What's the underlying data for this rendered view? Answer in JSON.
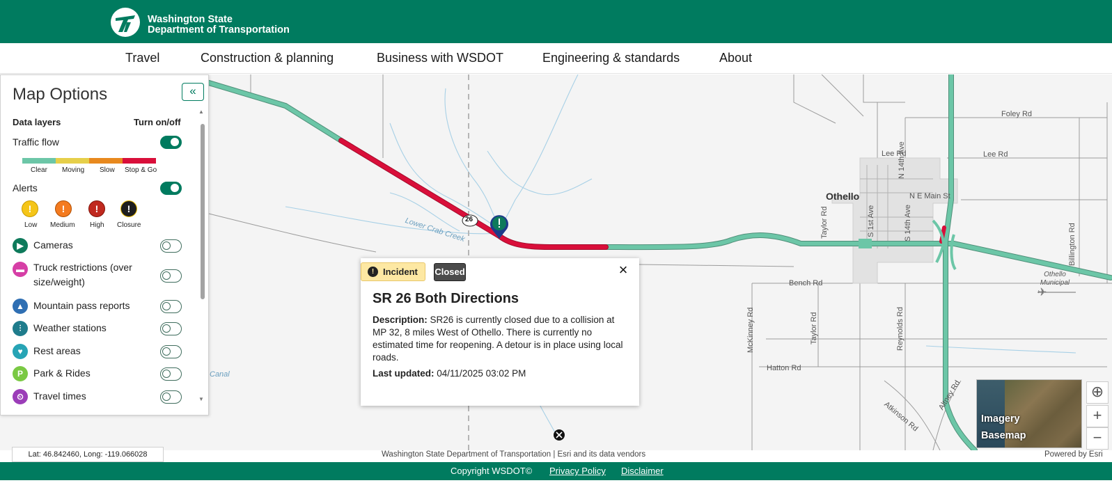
{
  "header": {
    "brand_line1": "Washington State",
    "brand_line2": "Department of Transportation",
    "logo_icon": "wsdot-logo-icon",
    "color": "#007b5f"
  },
  "nav": {
    "items": [
      {
        "label": "Travel"
      },
      {
        "label": "Construction & planning"
      },
      {
        "label": "Business with WSDOT"
      },
      {
        "label": "Engineering & standards"
      },
      {
        "label": "About"
      }
    ]
  },
  "panel": {
    "title": "Map Options",
    "collapse_icon": "double-chevron-left-icon",
    "col_layers": "Data layers",
    "col_toggle": "Turn on/off",
    "traffic_flow": {
      "label": "Traffic flow",
      "on": true,
      "legend": [
        {
          "label": "Clear",
          "color": "#6cc6a7"
        },
        {
          "label": "Moving",
          "color": "#e6cf4a"
        },
        {
          "label": "Slow",
          "color": "#e8891e"
        },
        {
          "label": "Stop & Go",
          "color": "#d90f3a"
        }
      ]
    },
    "alerts": {
      "label": "Alerts",
      "on": true,
      "levels": [
        {
          "label": "Low",
          "color": "#f5c518"
        },
        {
          "label": "Medium",
          "color": "#f47b20"
        },
        {
          "label": "High",
          "color": "#c0291f"
        },
        {
          "label": "Closure",
          "color": "#1e1e1e"
        }
      ]
    },
    "layers": [
      {
        "label": "Cameras",
        "icon": "camera-icon",
        "color": "#0e7a5b",
        "on": false
      },
      {
        "label": "Truck restrictions (over size/weight)",
        "icon": "truck-icon",
        "color": "#d63fa6",
        "on": false
      },
      {
        "label": "Mountain pass reports",
        "icon": "mountain-icon",
        "color": "#2f6fb3",
        "on": false
      },
      {
        "label": "Weather stations",
        "icon": "weather-station-icon",
        "color": "#1f7c8c",
        "on": false
      },
      {
        "label": "Rest areas",
        "icon": "rest-area-icon",
        "color": "#27a4b5",
        "on": false
      },
      {
        "label": "Park & Rides",
        "icon": "park-and-ride-icon",
        "color": "#7ac943",
        "on": false
      },
      {
        "label": "Travel times",
        "icon": "travel-times-icon",
        "color": "#9b3db8",
        "on": false
      }
    ]
  },
  "popup": {
    "badge_type": "Incident",
    "badge_status": "Closed",
    "close_icon": "close-icon",
    "title": "SR 26 Both Directions",
    "desc_label": "Description:",
    "desc_text": "SR26 is currently closed due to a collision at MP 32, 8 miles West of Othello. There is currently no estimated time for reopening. A detour is in place using local roads.",
    "updated_label": "Last updated:",
    "updated_value": "04/11/2025 03:02 PM"
  },
  "map": {
    "route_shield": "26",
    "labels": {
      "foley": "Foley Rd",
      "lee_east": "Lee Rd",
      "lee_town": "Lee Rd",
      "othello": "Othello",
      "ne_main": "N E Main St",
      "n14": "N 14th Ave",
      "s14": "S 14th Ave",
      "s1st": "S 1st Ave",
      "taylor_n": "Taylor Rd",
      "taylor_s": "Taylor Rd",
      "bench": "Bench Rd",
      "mckinney": "McKinney Rd",
      "reynolds": "Reynolds Rd",
      "hatton": "Hatton Rd",
      "atkinson": "Atkinson Rd",
      "altney": "Altney Rd",
      "billington": "Billington Rd",
      "airport": "Othello Municipal",
      "creek": "Lower Crab Creek",
      "canal": "Canal"
    },
    "coords": "Lat: 46.842460, Long: -119.066028",
    "attribution": "Washington State Department of Transportation | Esri and its data vendors",
    "powered_by": "Powered by Esri",
    "basemap_line1": "Imagery",
    "basemap_line2": "Basemap",
    "controls": {
      "locate_icon": "locate-icon",
      "zoom_in_icon": "plus-icon",
      "zoom_out_icon": "minus-icon"
    }
  },
  "footer": {
    "copyright": "Copyright WSDOT©",
    "privacy": "Privacy Policy",
    "disclaimer": "Disclaimer"
  }
}
